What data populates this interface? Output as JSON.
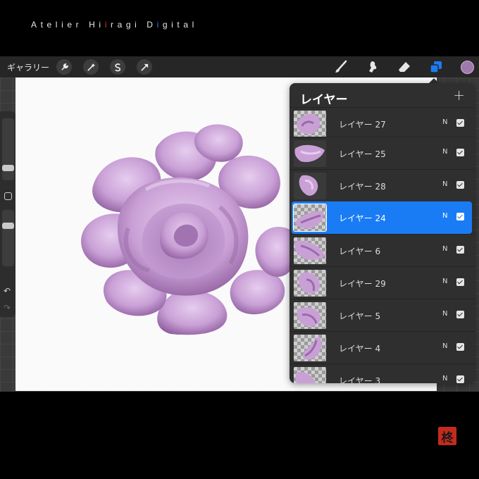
{
  "brand": {
    "part1": "Atelier Hi",
    "part2": "i",
    "part3": "ragi D",
    "part4": "i",
    "part5": "gital"
  },
  "toolbar": {
    "gallery_label": "ギャラリー",
    "left_tools": [
      "wrench-icon",
      "magic-wand-icon",
      "selection-icon",
      "transform-arrow-icon"
    ],
    "right_tools": [
      "brush-icon",
      "smudge-icon",
      "eraser-icon",
      "layers-icon"
    ],
    "current_color": "#a079ac",
    "active_tool_color": "#1a7cf5"
  },
  "layers_panel": {
    "title": "レイヤー",
    "add_label": "+",
    "layers": [
      {
        "name": "レイヤー 27",
        "blend": "N",
        "visible": true,
        "selected": false
      },
      {
        "name": "レイヤー 25",
        "blend": "N",
        "visible": true,
        "selected": false
      },
      {
        "name": "レイヤー 28",
        "blend": "N",
        "visible": true,
        "selected": false
      },
      {
        "name": "レイヤー 24",
        "blend": "N",
        "visible": true,
        "selected": true
      },
      {
        "name": "レイヤー 6",
        "blend": "N",
        "visible": true,
        "selected": false
      },
      {
        "name": "レイヤー 29",
        "blend": "N",
        "visible": true,
        "selected": false
      },
      {
        "name": "レイヤー 5",
        "blend": "N",
        "visible": true,
        "selected": false
      },
      {
        "name": "レイヤー 4",
        "blend": "N",
        "visible": true,
        "selected": false
      },
      {
        "name": "レイヤー 3",
        "blend": "N",
        "visible": true,
        "selected": false
      }
    ]
  },
  "seal_char": "柊",
  "colors": {
    "petal": "#c9a0d6",
    "petal_shadow": "#9a6ba8",
    "selection": "#1a7cf5"
  }
}
